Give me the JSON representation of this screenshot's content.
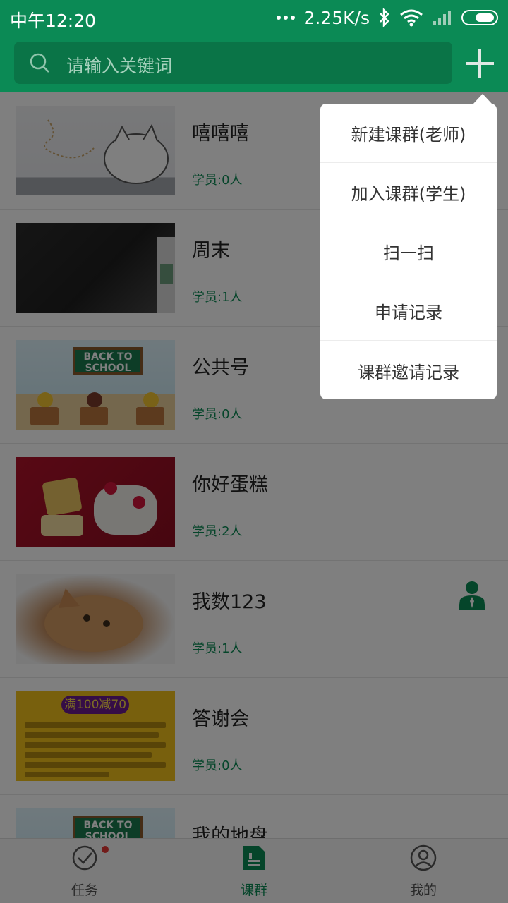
{
  "status_bar": {
    "time": "中午12:20",
    "network_speed": "2.25K/s",
    "icons": [
      "more-dots-icon",
      "bluetooth-icon",
      "wifi-icon",
      "signal-icon",
      "battery-icon"
    ]
  },
  "header": {
    "search_placeholder": "请输入关键词",
    "add_icon": "plus-icon"
  },
  "groups": [
    {
      "title": "嘻嘻嘻",
      "members": "学员:0人"
    },
    {
      "title": "周末",
      "members": "学员:1人"
    },
    {
      "title": "公共号",
      "members": "学员:0人"
    },
    {
      "title": "你好蛋糕",
      "members": "学员:2人"
    },
    {
      "title": "我数123",
      "members": "学员:1人"
    },
    {
      "title": "答谢会",
      "members": "学员:0人"
    },
    {
      "title": "我的地盘",
      "members": ""
    }
  ],
  "thumb_text": {
    "school_board": "BACK TO SCHOOL",
    "promo_title": "满100减70"
  },
  "popup_menu": {
    "items": [
      "新建课群(老师)",
      "加入课群(学生)",
      "扫一扫",
      "申请记录",
      "课群邀请记录"
    ]
  },
  "tabbar": {
    "tabs": [
      {
        "label": "任务",
        "icon": "task-check-icon"
      },
      {
        "label": "课群",
        "icon": "class-group-icon"
      },
      {
        "label": "我的",
        "icon": "profile-icon"
      }
    ],
    "active": "课群"
  },
  "colors": {
    "brand_green": "#0b8a55",
    "overlay": "rgba(0,0,0,0.5)",
    "badge_red": "#e53935"
  }
}
